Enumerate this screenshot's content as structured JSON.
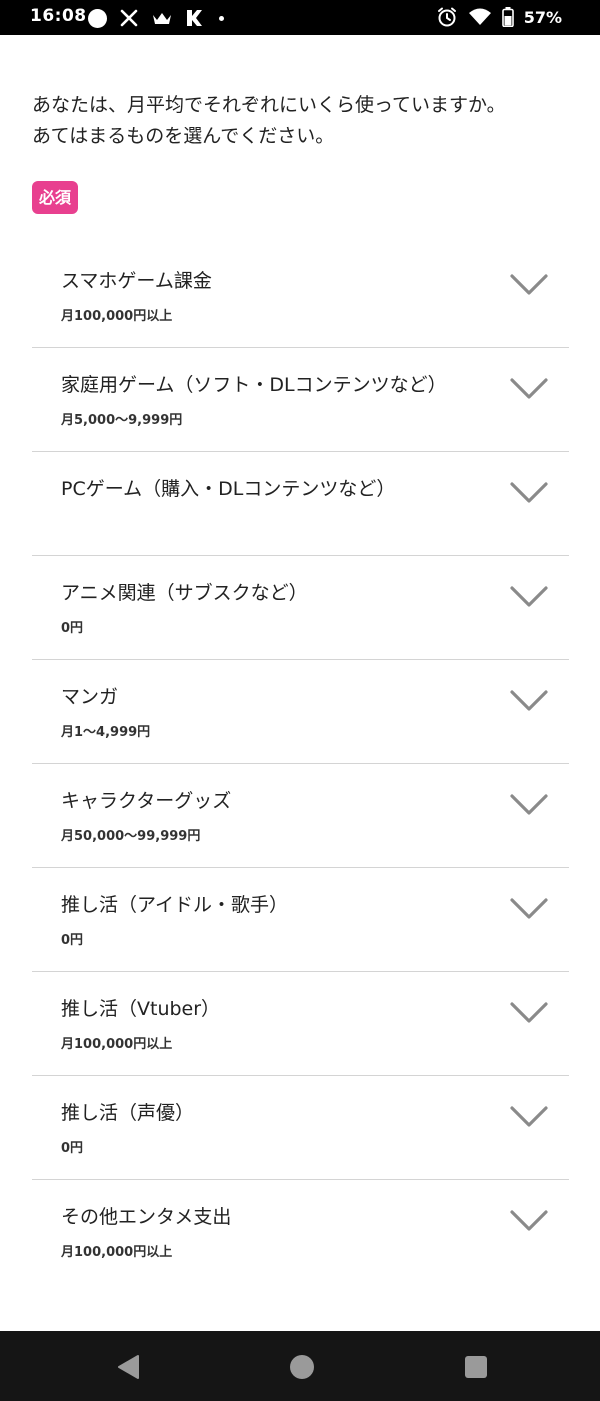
{
  "status_bar": {
    "time": "16:08",
    "battery": "57%",
    "left_icons": [
      "circle-icon",
      "x-logo-icon",
      "crown-icon",
      "k-logo-icon",
      "dot-icon"
    ],
    "right_icons": [
      "alarm-icon",
      "wifi-icon",
      "battery-icon"
    ]
  },
  "question": {
    "line1": "あなたは、月平均でそれぞれにいくら使っていますか。",
    "line2": "あてはまるものを選んでください。"
  },
  "required_label": "必須",
  "categories": [
    {
      "title": "スマホゲーム課金",
      "value": "月100,000円以上"
    },
    {
      "title": "家庭用ゲーム（ソフト・DLコンテンツなど）",
      "value": "月5,000〜9,999円"
    },
    {
      "title": "PCゲーム（購入・DLコンテンツなど）",
      "value": ""
    },
    {
      "title": "アニメ関連（サブスクなど）",
      "value": "0円"
    },
    {
      "title": "マンガ",
      "value": "月1〜4,999円"
    },
    {
      "title": "キャラクターグッズ",
      "value": "月50,000〜99,999円"
    },
    {
      "title": "推し活（アイドル・歌手）",
      "value": "0円"
    },
    {
      "title": "推し活（Vtuber）",
      "value": "月100,000円以上"
    },
    {
      "title": "推し活（声優）",
      "value": "0円"
    },
    {
      "title": "その他エンタメ支出",
      "value": "月100,000円以上"
    }
  ],
  "icons": {
    "chevron": "chevron-down-icon",
    "nav": [
      "back-icon",
      "home-icon",
      "recents-icon"
    ]
  },
  "colors": {
    "required_badge": "#e8408f",
    "chevron": "#8a8a8a",
    "divider": "#d4d4d4",
    "status_bar": "#000000",
    "nav_bar": "#151515"
  }
}
